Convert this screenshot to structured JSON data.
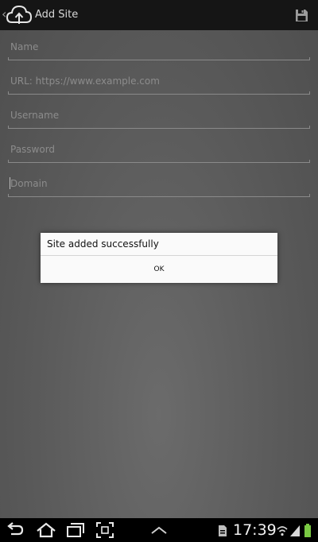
{
  "action_bar": {
    "title": "Add Site",
    "up_icon": "chevron-left-icon",
    "app_icon": "cloud-upload-icon",
    "save_icon": "floppy-disk-icon"
  },
  "form": {
    "fields": [
      {
        "placeholder": "Name"
      },
      {
        "placeholder": "URL: https://www.example.com"
      },
      {
        "placeholder": "Username"
      },
      {
        "placeholder": "Password"
      },
      {
        "placeholder": "Domain"
      }
    ]
  },
  "dialog": {
    "message": "Site added successfully",
    "ok_label": "OK"
  },
  "system_bar": {
    "time": "17:39",
    "icons": [
      "back-icon",
      "home-icon",
      "recent-apps-icon",
      "screenshot-icon",
      "menu-up-icon",
      "notification-icon",
      "wifi-icon",
      "signal-icon",
      "battery-icon"
    ]
  },
  "colors": {
    "action_bar_bg": "#151515",
    "dim_overlay": "#5a5a5a",
    "dialog_bg": "#fafafa"
  }
}
